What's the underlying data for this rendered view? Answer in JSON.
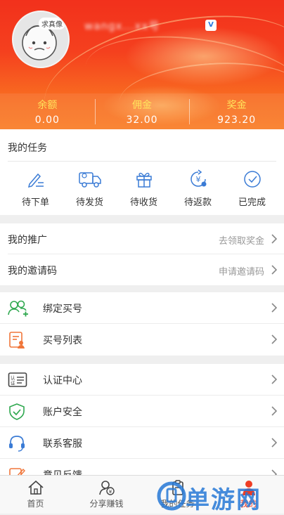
{
  "profile": {
    "avatar_tag": "求真像",
    "username": "wangx...xx号",
    "vip_badge": "V"
  },
  "stats": [
    {
      "label": "余额",
      "value": "0.00"
    },
    {
      "label": "佣金",
      "value": "32.00"
    },
    {
      "label": "奖金",
      "value": "923.20"
    }
  ],
  "tasks": {
    "title": "我的任务",
    "items": [
      {
        "label": "待下单",
        "icon": "edit-list-icon"
      },
      {
        "label": "待发货",
        "icon": "truck-icon"
      },
      {
        "label": "待收货",
        "icon": "gift-box-icon"
      },
      {
        "label": "待返款",
        "icon": "refund-yen-icon"
      },
      {
        "label": "已完成",
        "icon": "check-circle-icon"
      }
    ]
  },
  "promo": {
    "items": [
      {
        "label": "我的推广",
        "hint": "去领取奖金"
      },
      {
        "label": "我的邀请码",
        "hint": "申请邀请码"
      }
    ]
  },
  "account": {
    "items": [
      {
        "label": "绑定买号",
        "icon": "add-users-icon"
      },
      {
        "label": "买号列表",
        "icon": "user-list-icon"
      }
    ]
  },
  "security": {
    "items": [
      {
        "label": "认证中心",
        "icon": "certification-icon"
      },
      {
        "label": "账户安全",
        "icon": "shield-check-icon"
      },
      {
        "label": "联系客服",
        "icon": "headset-icon"
      },
      {
        "label": "意见反馈",
        "icon": "feedback-icon"
      }
    ]
  },
  "tabbar": {
    "items": [
      {
        "label": "首页",
        "icon": "home-icon"
      },
      {
        "label": "分享赚钱",
        "icon": "share-money-icon"
      },
      {
        "label": "我的任务",
        "icon": "task-clipboard-icon"
      },
      {
        "label": "我的",
        "icon": "user-icon"
      }
    ]
  },
  "watermark": {
    "text": "单游网"
  },
  "colors": {
    "accent": "#ef3d24",
    "stat_label": "#ffe45c",
    "icon_blue": "#3a7bd5",
    "icon_green": "#2fa84f",
    "icon_orange": "#f0763a"
  }
}
